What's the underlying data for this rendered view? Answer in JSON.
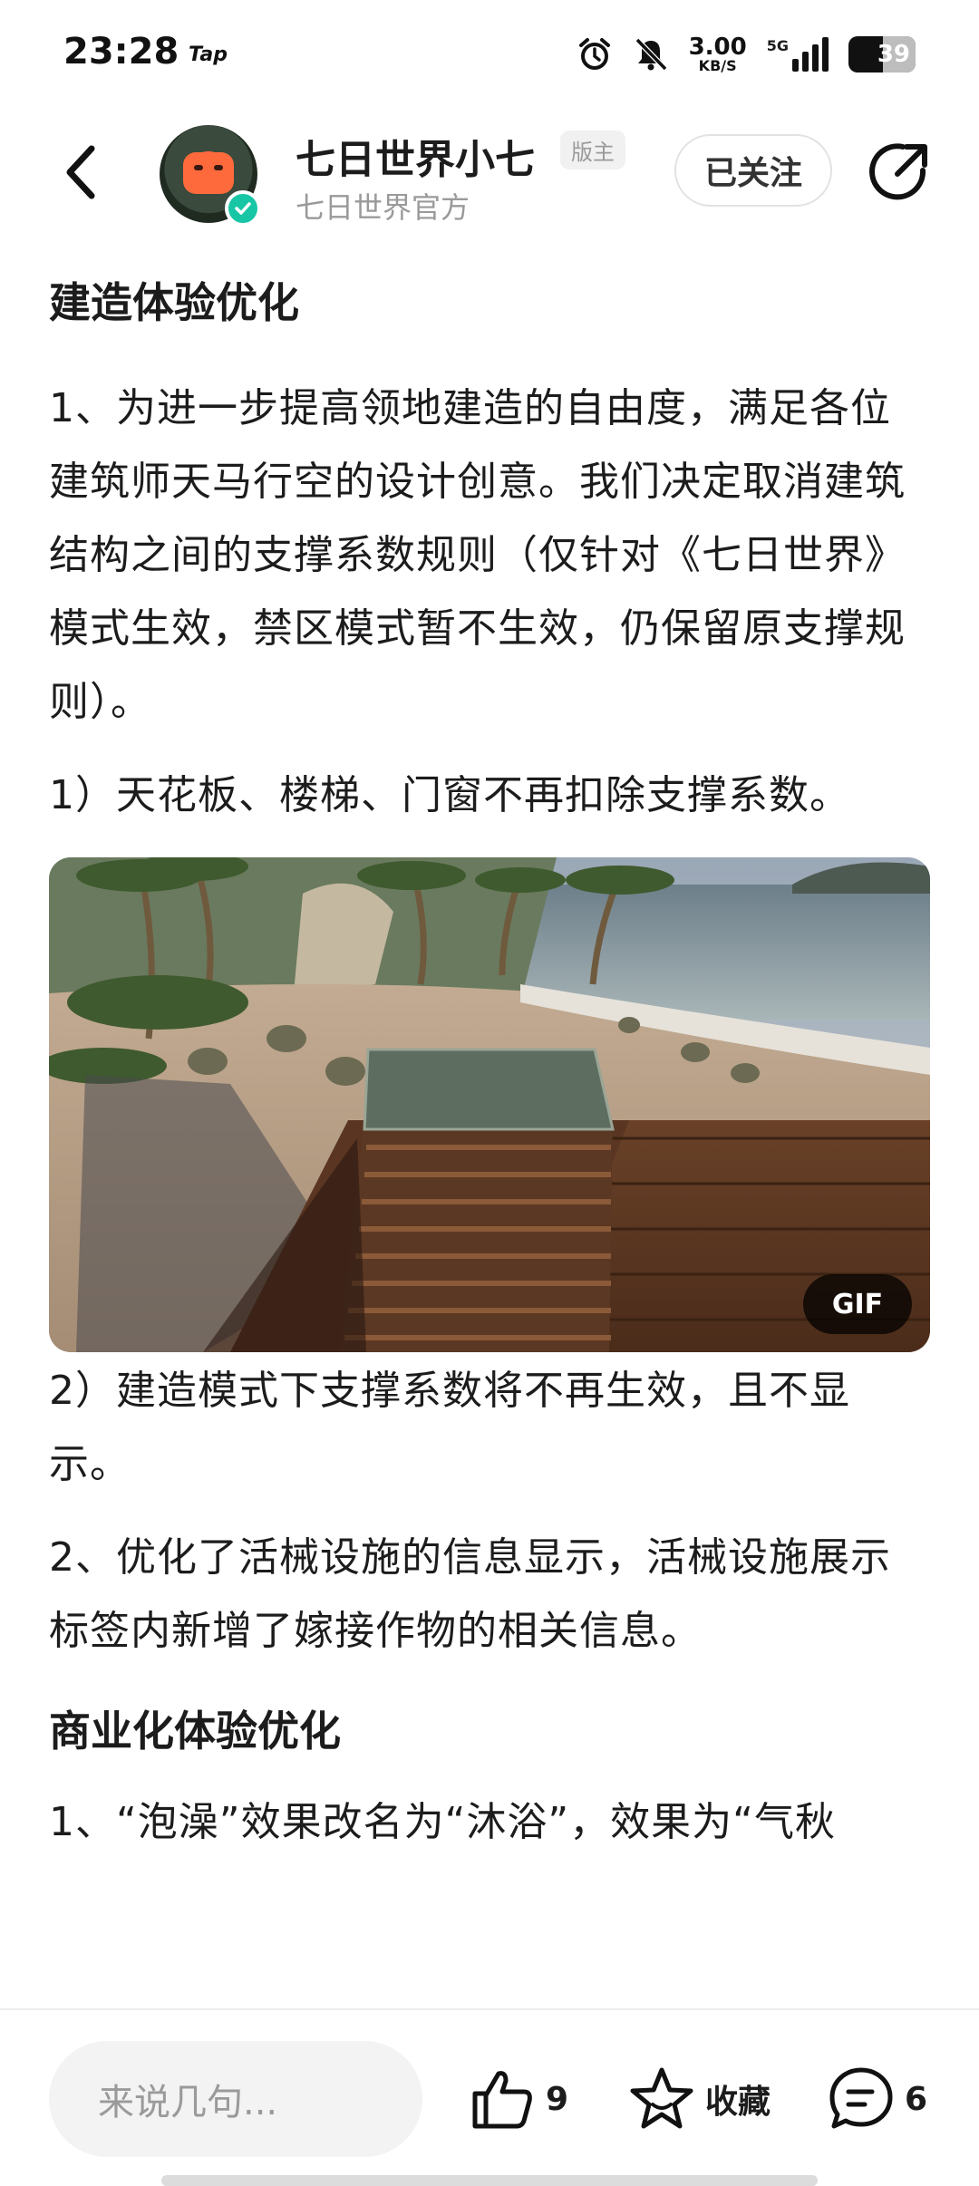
{
  "status": {
    "time": "23:28",
    "app_tag": "Tap",
    "net_speed_value": "3.00",
    "net_speed_unit": "KB/S",
    "signal_type": "5G",
    "battery": "39",
    "icons": [
      "alarm-icon",
      "mute-icon",
      "signal-icon",
      "battery-icon"
    ]
  },
  "header": {
    "author_name": "七日世界小七",
    "mod_badge": "版主",
    "author_subtitle": "七日世界官方",
    "follow_label": "已关注",
    "icons": [
      "back-icon",
      "verified-icon",
      "share-icon"
    ]
  },
  "article": {
    "section1_title": "建造体验优化",
    "p1": "1、为进一步提高领地建造的自由度，满足各位建筑师天马行空的设计创意。我们决定取消建筑结构之间的支撑系数规则（仅针对《七日世界》模式生效，禁区模式暂不生效，仍保留原支撑规则）。",
    "p2": "1）天花板、楼梯、门窗不再扣除支撑系数。",
    "gif_badge": "GIF",
    "p3": "2）建造模式下支撑系数将不再生效，且不显示。",
    "p4": "2、优化了活械设施的信息显示，活械设施展示标签内新增了嫁接作物的相关信息。",
    "section2_title": "商业化体验优化",
    "p5_partial": "1、“泡澡”效果改名为“沐浴”，效果为“气秋"
  },
  "bottom_bar": {
    "comment_placeholder": "来说几句...",
    "like_count": "9",
    "favorite_label": "收藏",
    "comment_count": "6",
    "icons": [
      "thumbs-up-icon",
      "star-icon",
      "comment-icon"
    ]
  }
}
